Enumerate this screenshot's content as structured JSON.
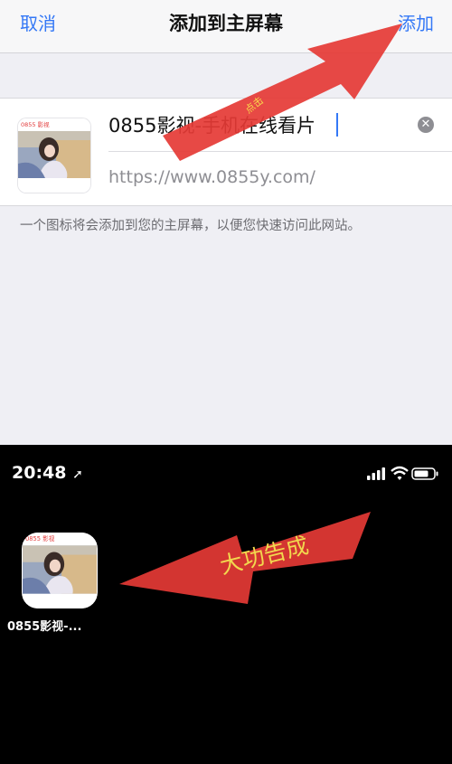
{
  "sheet": {
    "cancel_label": "取消",
    "title": "添加到主屏幕",
    "add_label": "添加",
    "app_name": "0855影视-手机在线看片",
    "url": "https://www.0855y.com/",
    "hint": "一个图标将会添加到您的主屏幕，以便您快速访问此网站。",
    "thumb_logo": "0855 影视"
  },
  "homescreen": {
    "time": "20:48",
    "app_label": "0855影视-..."
  },
  "annotations": {
    "tap_label": "点击",
    "done_label": "大功告成"
  },
  "colors": {
    "accent": "#3478f6",
    "arrow": "#e53935",
    "annotation_text": "#f2d84e"
  }
}
